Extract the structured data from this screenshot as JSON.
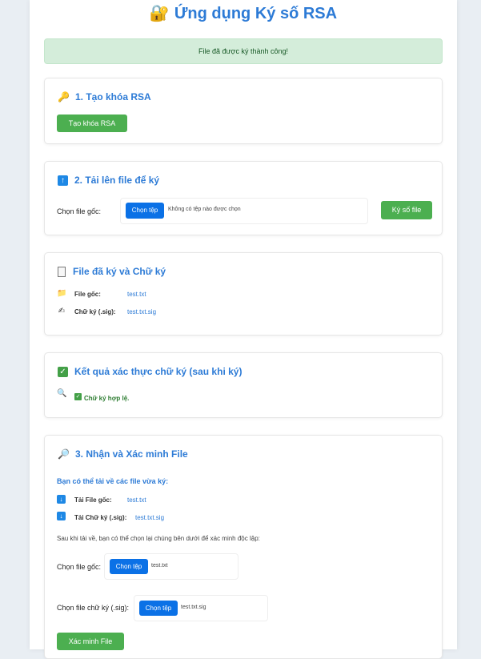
{
  "app": {
    "title": "Ứng dụng Ký số RSA",
    "title_icon": "lock-key-icon",
    "alert": "File đã được ký thành công!"
  },
  "keygen": {
    "heading": "1. Tạo khóa RSA",
    "icon": "key-icon",
    "button": "Tạo khóa RSA"
  },
  "upload": {
    "heading": "2. Tải lên file để ký",
    "icon": "upload-arrow-icon",
    "label": "Chọn file gốc:",
    "choose_button": "Chọn tệp",
    "no_file_text": "Không có tệp nào được chọn",
    "sign_button": "Ký số file"
  },
  "signed": {
    "heading": "File đã ký và Chữ ký",
    "icon": "document-icon",
    "original_label": "File gốc:",
    "original_file": "test.txt",
    "signature_label": "Chữ ký (.sig):",
    "signature_file": "test.txt.sig"
  },
  "verify_result": {
    "heading": "Kết quả xác thực chữ ký (sau khi ký)",
    "icon": "check-mark-icon",
    "message": "Chữ ký hợp lệ."
  },
  "receive": {
    "heading": "3. Nhận và Xác minh File",
    "icon": "magnifier-icon",
    "subheading": "Bạn có thể tải về các file vừa ký:",
    "download_original_label": "Tải File gốc:",
    "download_original_file": "test.txt",
    "download_signature_label": "Tải Chữ ký (.sig):",
    "download_signature_file": "test.txt.sig",
    "instruction": "Sau khi tải về, bạn có thể chọn lại chúng bên dưới để xác minh độc lập:",
    "original_input_label": "Chọn file gốc:",
    "original_choose_button": "Chọn tệp",
    "original_selected": "test.txt",
    "signature_input_label": "Chọn file chữ ký (.sig):",
    "signature_choose_button": "Chọn tệp",
    "signature_selected": "test.txt.sig",
    "verify_button": "Xác minh File"
  },
  "colors": {
    "accent_blue": "#2d7bd6",
    "button_green": "#4caf50",
    "file_button_blue": "#0b71e6",
    "alert_bg": "#d4edda"
  }
}
